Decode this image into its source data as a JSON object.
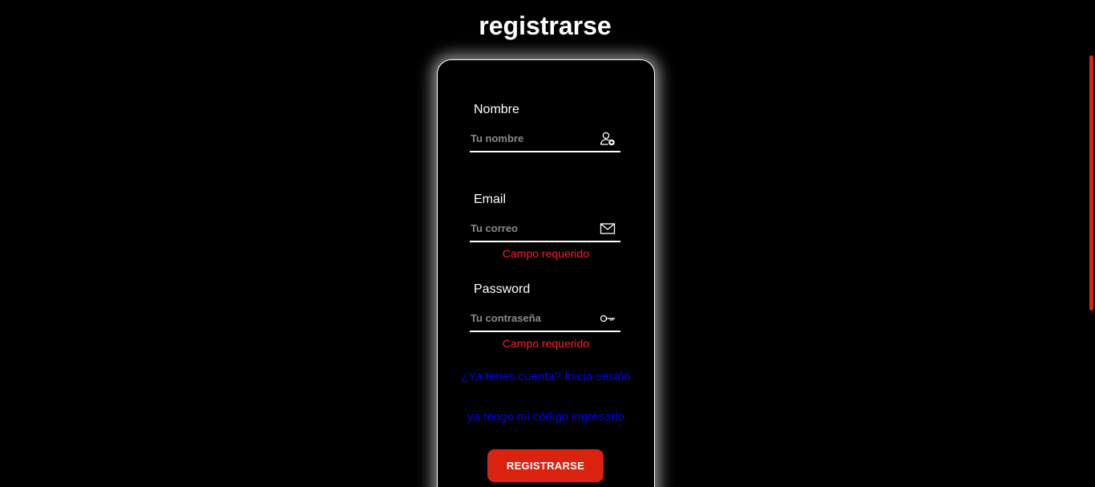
{
  "page": {
    "title": "registrarse"
  },
  "form": {
    "name": {
      "label": "Nombre",
      "placeholder": "Tu nombre",
      "value": "",
      "icon": "user-add-icon"
    },
    "email": {
      "label": "Email",
      "placeholder": "Tu correo",
      "value": "",
      "icon": "envelope-icon",
      "error": "Campo requerido"
    },
    "password": {
      "label": "Password",
      "placeholder": "Tu contraseña",
      "value": "",
      "icon": "key-icon",
      "error": "Campo requerido"
    },
    "login_link": "¿Ya tenes cuenta? Inicia sesión",
    "code_link": "ya tengo mi código ingresarlo",
    "submit_label": "REGISTRARSE"
  },
  "colors": {
    "background": "#000000",
    "accent": "#d9230f",
    "error": "#ff1a2e",
    "link": "#0000ee",
    "text": "#ffffff"
  }
}
